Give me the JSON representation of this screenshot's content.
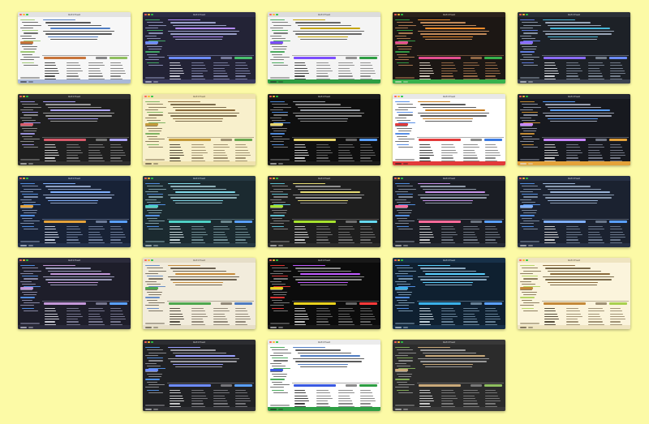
{
  "page": {
    "background": "#fcfaa6"
  },
  "window_title": "Untitled",
  "themes": [
    {
      "bg": "#f7f7f7",
      "bar": "#e2e2e2",
      "text": "#2a2a2a",
      "accent": "#c8743a",
      "accent2": "#8fbf5f",
      "code": "#4f7cc2",
      "status": "#a9b8d8",
      "fg": "#555555"
    },
    {
      "bg": "#232336",
      "bar": "#2c2c44",
      "text": "#e6e6f0",
      "accent": "#6d8cff",
      "accent2": "#49c06e",
      "code": "#b48cff",
      "status": "#3a3a5e",
      "fg": "#9aa0c8"
    },
    {
      "bg": "#f4f4f4",
      "bar": "#dcdcdc",
      "text": "#2a2a2a",
      "accent": "#7c4dff",
      "accent2": "#2e9e44",
      "code": "#c5a400",
      "status": "#2e9e44",
      "fg": "#666666"
    },
    {
      "bg": "#1c1714",
      "bar": "#2a211b",
      "text": "#f0e6d6",
      "accent": "#e44f91",
      "accent2": "#37b24d",
      "code": "#f08c2c",
      "status": "#37b24d",
      "fg": "#c28a5a"
    },
    {
      "bg": "#1d2127",
      "bar": "#2a2f37",
      "text": "#e6e9ee",
      "accent": "#8b6cff",
      "accent2": "#6c8cff",
      "code": "#49b7d8",
      "status": "#3b4250",
      "fg": "#9aa6b8"
    },
    {
      "bg": "#1f1f1f",
      "bar": "#2d2d2d",
      "text": "#e6e6e6",
      "accent": "#d85a6a",
      "accent2": "#b0a7ff",
      "code": "#b0a7ff",
      "status": "#2d2d2d",
      "fg": "#9a9a9a"
    },
    {
      "bg": "#f8f0cc",
      "bar": "#efe2ad",
      "text": "#3a3020",
      "accent": "#c49a3a",
      "accent2": "#6aa84f",
      "code": "#8a6a3a",
      "status": "#efe2ad",
      "fg": "#7a6a4a"
    },
    {
      "bg": "#0f0f0f",
      "bar": "#1a1a1a",
      "text": "#e6e6e6",
      "accent": "#e8d56a",
      "accent2": "#5aa0ff",
      "code": "#9aa0a8",
      "status": "#1a1a1a",
      "fg": "#8a8a8a"
    },
    {
      "bg": "#ffffff",
      "bar": "#e8e8e8",
      "text": "#1e1e1e",
      "accent": "#e23a3a",
      "accent2": "#3a7ae2",
      "code": "#c67a1a",
      "status": "#e23a3a",
      "fg": "#5a5a5a"
    },
    {
      "bg": "#17191f",
      "bar": "#23262f",
      "text": "#e6e6e6",
      "accent": "#c987ff",
      "accent2": "#e4a23a",
      "code": "#5aa0ff",
      "status": "#e4a23a",
      "fg": "#9aa0b0"
    },
    {
      "bg": "#182236",
      "bar": "#22304a",
      "text": "#dfe8f8",
      "accent": "#e4a23a",
      "accent2": "#5aa0ff",
      "code": "#7fb0ff",
      "status": "#22304a",
      "fg": "#8ea0c0"
    },
    {
      "bg": "#1b2a30",
      "bar": "#253841",
      "text": "#dfeef2",
      "accent": "#4fd1c5",
      "accent2": "#5aa0ff",
      "code": "#7fd8e8",
      "status": "#253841",
      "fg": "#8eb0b8"
    },
    {
      "bg": "#1e1e1e",
      "bar": "#2b2b2b",
      "text": "#e6e6e6",
      "accent": "#a6e22e",
      "accent2": "#66d9ef",
      "code": "#e6db74",
      "status": "#2b2b2b",
      "fg": "#909090"
    },
    {
      "bg": "#1a1d24",
      "bar": "#252a34",
      "text": "#e6e6e6",
      "accent": "#ff6b9a",
      "accent2": "#5aa0ff",
      "code": "#c792ea",
      "status": "#252a34",
      "fg": "#909aa8"
    },
    {
      "bg": "#1b2230",
      "bar": "#263044",
      "text": "#e6e6e6",
      "accent": "#7fb0ff",
      "accent2": "#5aa0ff",
      "code": "#9ab4d8",
      "status": "#263044",
      "fg": "#8a9ab0"
    },
    {
      "bg": "#1e1e2a",
      "bar": "#2a2a3a",
      "text": "#e6e6f0",
      "accent": "#c397d8",
      "accent2": "#5aa0ff",
      "code": "#c397d8",
      "status": "#2a2a3a",
      "fg": "#9a9ab8"
    },
    {
      "bg": "#f2ecdc",
      "bar": "#e6dec8",
      "text": "#3a3428",
      "accent": "#4fa84f",
      "accent2": "#4f7cc2",
      "code": "#c58a3a",
      "status": "#e6dec8",
      "fg": "#6a6050"
    },
    {
      "bg": "#0c0c0c",
      "bar": "#181818",
      "text": "#e6e6e6",
      "accent": "#e8d01e",
      "accent2": "#ff3a3a",
      "code": "#c05aff",
      "status": "#181818",
      "fg": "#8a8a8a"
    },
    {
      "bg": "#0f2030",
      "bar": "#173048",
      "text": "#dfeef8",
      "accent": "#3ab0e8",
      "accent2": "#5aa0ff",
      "code": "#5ad0ff",
      "status": "#173048",
      "fg": "#8aa8c0"
    },
    {
      "bg": "#fbf4dc",
      "bar": "#efe4c0",
      "text": "#3a3020",
      "accent": "#c48a3a",
      "accent2": "#a8d04f",
      "code": "#8a6a3a",
      "status": "#efe4c0",
      "fg": "#7a6a4a"
    },
    {
      "bg": "#202124",
      "bar": "#2c2d31",
      "text": "#e6e6e6",
      "accent": "#6d8cff",
      "accent2": "#5aa0ff",
      "code": "#9aa0ff",
      "status": "#2c2d31",
      "fg": "#9a9aa0"
    },
    {
      "bg": "#ffffff",
      "bar": "#ececec",
      "text": "#1e1e1e",
      "accent": "#3a5ae2",
      "accent2": "#2e9e44",
      "code": "#4f7cc2",
      "status": "#2e9e44",
      "fg": "#5a5a5a"
    },
    {
      "bg": "#2b2b2b",
      "bar": "#383838",
      "text": "#e6e6e6",
      "accent": "#c9a97a",
      "accent2": "#8fbf5f",
      "code": "#c9a97a",
      "status": "#383838",
      "fg": "#9a9a9a"
    }
  ]
}
